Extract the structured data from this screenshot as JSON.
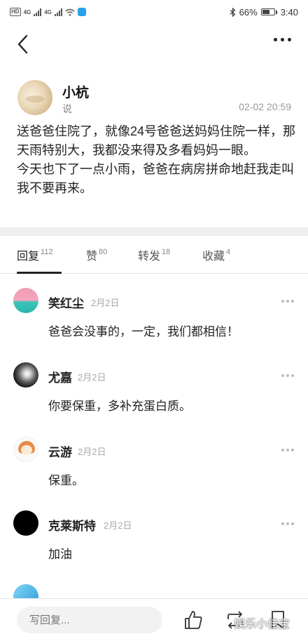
{
  "status_bar": {
    "network_label": "4G",
    "network_label_2": "4G",
    "battery_percent": "66%",
    "battery_level": 0.66,
    "time": "3:40"
  },
  "post": {
    "author": "小杭",
    "verb": "说",
    "timestamp": "02-02 20:59",
    "body": "送爸爸住院了，就像24号爸爸送妈妈住院一样，那天雨特别大，我都没来得及多看妈妈一眼。\n今天也下了一点小雨，爸爸在病房拼命地赶我走叫我不要再来。"
  },
  "tabs": [
    {
      "label": "回复",
      "count": "112"
    },
    {
      "label": "赞",
      "count": "80"
    },
    {
      "label": "转发",
      "count": "18"
    },
    {
      "label": "收藏",
      "count": "4"
    }
  ],
  "comments": [
    {
      "name": "笑红尘",
      "date": "2月2日",
      "text": "爸爸会没事的，一定，我们都相信！"
    },
    {
      "name": "尤嘉",
      "date": "2月2日",
      "text": "你要保重，多补充蛋白质。"
    },
    {
      "name": "云游",
      "date": "2月2日",
      "text": "保重。"
    },
    {
      "name": "克莱斯特",
      "date": "2月2日",
      "text": "加油"
    }
  ],
  "bottom_bar": {
    "reply_placeholder": "写回复...",
    "watermark": "娱乐小佳宝"
  },
  "icons": {
    "back": "chevron-left-icon",
    "more": "more-dots-icon",
    "like": "thumb-up-icon",
    "repost": "repost-icon",
    "bookmark": "bookmark-icon"
  }
}
